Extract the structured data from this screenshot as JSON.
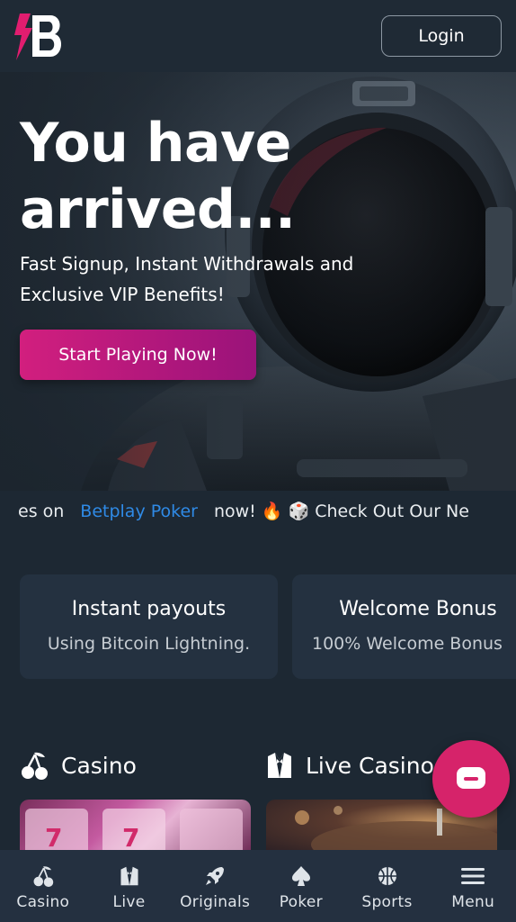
{
  "header": {
    "logo_alt": "B",
    "login_label": "Login"
  },
  "hero": {
    "title_line1": "You have",
    "title_line2": "arrived...",
    "subtitle": "Fast Signup, Instant Withdrawals and Exclusive VIP Benefits!",
    "cta_label": "Start Playing Now!"
  },
  "ticker": {
    "lead": "es on",
    "link": "Betplay Poker",
    "rest": "now! 🔥 🎲 Check Out Our Ne"
  },
  "cards": [
    {
      "title": "Instant payouts",
      "subtitle": "Using Bitcoin Lightning."
    },
    {
      "title": "Welcome Bonus",
      "subtitle": "100% Welcome Bonus"
    }
  ],
  "sections": [
    {
      "label": "Casino",
      "icon": "cherries-icon"
    },
    {
      "label": "Live Casino",
      "icon": "tuxedo-icon"
    }
  ],
  "bottom_nav": [
    {
      "label": "Casino",
      "icon": "cherries-icon"
    },
    {
      "label": "Live",
      "icon": "tuxedo-icon"
    },
    {
      "label": "Originals",
      "icon": "rocket-icon"
    },
    {
      "label": "Poker",
      "icon": "spade-icon"
    },
    {
      "label": "Sports",
      "icon": "basketball-icon"
    },
    {
      "label": "Menu",
      "icon": "hamburger-icon"
    }
  ],
  "colors": {
    "brand_pink": "#d6236a",
    "background": "#1d2833",
    "card": "#243140",
    "link_blue": "#2f8ae6"
  }
}
